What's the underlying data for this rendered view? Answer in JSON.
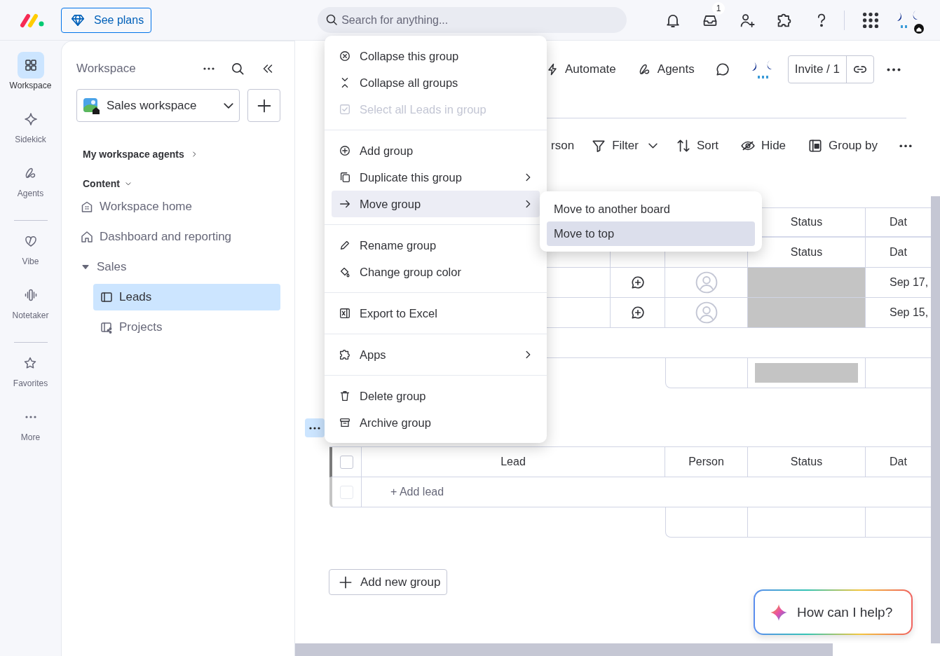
{
  "topbar": {
    "plans_button": "See plans",
    "search": {
      "placeholder": "Search for anything..."
    },
    "inbox_badge": "1"
  },
  "nav": {
    "items": [
      {
        "label": "Workspace",
        "selected": true
      },
      {
        "label": "Sidekick",
        "selected": false
      },
      {
        "label": "Agents",
        "selected": false
      },
      {
        "label": "Vibe",
        "selected": false
      },
      {
        "label": "Notetaker",
        "selected": false
      },
      {
        "label": "Favorites",
        "selected": false
      },
      {
        "label": "More",
        "selected": false
      }
    ]
  },
  "sidebar": {
    "title": "Workspace",
    "workspace_select": "Sales workspace",
    "agents_link": "My workspace agents",
    "section": {
      "label": "Content",
      "expanded": true
    },
    "items": [
      {
        "label": "Workspace home",
        "selected": false
      },
      {
        "label": "Dashboard and reporting",
        "selected": false
      },
      {
        "label": "Sales",
        "selected": false,
        "expanded": true,
        "children": [
          {
            "label": "Leads",
            "selected": true
          },
          {
            "label": "Projects",
            "selected": false
          }
        ]
      }
    ]
  },
  "board": {
    "automate_button": "Automate",
    "agents_button": "Agents",
    "invite_button": "Invite / 1",
    "view_toolbar": {
      "person_filter": "rson",
      "filter": "Filter",
      "sort": "Sort",
      "hide": "Hide",
      "group_by": "Group by"
    },
    "groups": [
      {
        "header_rows": [
          {
            "status": "Status",
            "date": "Dat"
          },
          {
            "status": "Status",
            "date": "Dat"
          }
        ],
        "rows": [
          {
            "date": "Sep 17,"
          },
          {
            "date": "Sep 15,"
          }
        ],
        "summary_status_filled": true
      },
      {
        "header_rows": [
          {
            "lead": "Lead",
            "person": "Person",
            "status": "Status",
            "date": "Dat"
          }
        ],
        "select_all_checked": false,
        "add_row": {
          "label": "+ Add lead",
          "checked": false
        },
        "summary_status_filled": false
      }
    ],
    "add_group_button": "Add new group"
  },
  "assistant_button": "How can I help?",
  "group_menu": {
    "sections": [
      [
        {
          "label": "Collapse this group",
          "disabled": false,
          "selected": false,
          "has_submenu": false
        },
        {
          "label": "Collapse all groups",
          "disabled": false,
          "selected": false,
          "has_submenu": false
        },
        {
          "label": "Select all Leads in group",
          "disabled": true,
          "selected": false,
          "has_submenu": false
        }
      ],
      [
        {
          "label": "Add group",
          "disabled": false,
          "selected": false,
          "has_submenu": false
        },
        {
          "label": "Duplicate this group",
          "disabled": false,
          "selected": false,
          "has_submenu": true
        },
        {
          "label": "Move group",
          "disabled": false,
          "selected": true,
          "has_submenu": true
        }
      ],
      [
        {
          "label": "Rename group",
          "disabled": false,
          "selected": false,
          "has_submenu": false
        },
        {
          "label": "Change group color",
          "disabled": false,
          "selected": false,
          "has_submenu": false
        }
      ],
      [
        {
          "label": "Export to Excel",
          "disabled": false,
          "selected": false,
          "has_submenu": false
        }
      ],
      [
        {
          "label": "Apps",
          "disabled": false,
          "selected": false,
          "has_submenu": true
        }
      ],
      [
        {
          "label": "Delete group",
          "disabled": false,
          "selected": false,
          "has_submenu": false
        },
        {
          "label": "Archive group",
          "disabled": false,
          "selected": false,
          "has_submenu": false
        }
      ]
    ],
    "submenu": {
      "items": [
        {
          "label": "Move to another board",
          "selected": false
        },
        {
          "label": "Move to top",
          "selected": true
        }
      ]
    }
  }
}
